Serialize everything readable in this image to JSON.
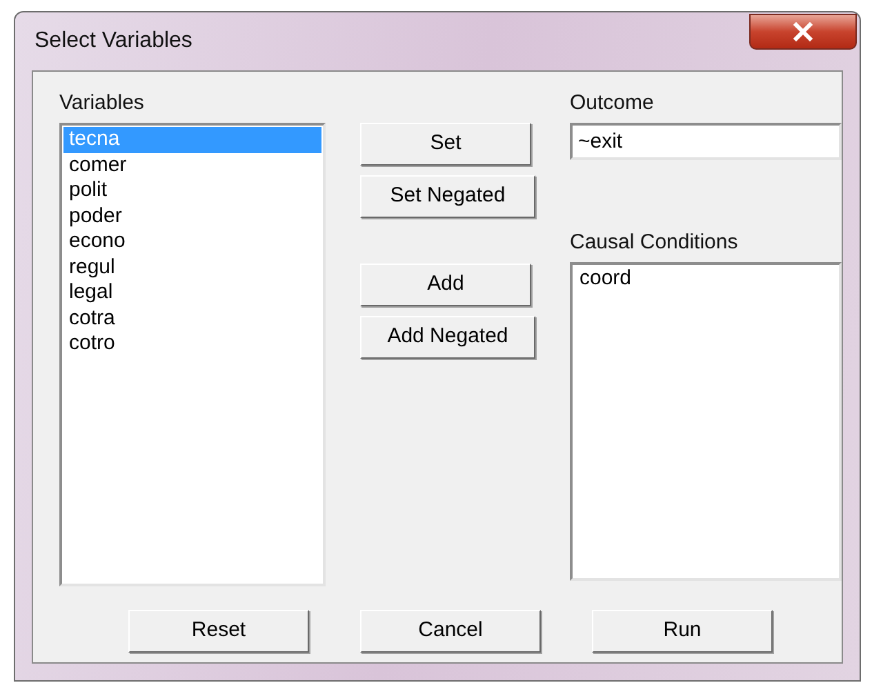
{
  "window": {
    "title": "Select Variables"
  },
  "variables": {
    "label": "Variables",
    "items": [
      {
        "text": "tecna",
        "selected": true
      },
      {
        "text": "comer",
        "selected": false
      },
      {
        "text": "polit",
        "selected": false
      },
      {
        "text": "poder",
        "selected": false
      },
      {
        "text": "econo",
        "selected": false
      },
      {
        "text": "regul",
        "selected": false
      },
      {
        "text": "legal",
        "selected": false
      },
      {
        "text": "cotra",
        "selected": false
      },
      {
        "text": "cotro",
        "selected": false
      }
    ]
  },
  "button_groups": [
    [
      "Set",
      "Set Negated"
    ],
    [
      "Add",
      "Add Negated"
    ]
  ],
  "outcome": {
    "label": "Outcome",
    "value": "~exit"
  },
  "causal_conditions": {
    "label": "Causal Conditions",
    "items": [
      {
        "text": "coord",
        "selected": false
      }
    ]
  },
  "footer_buttons": [
    "Reset",
    "Cancel",
    "Run"
  ]
}
